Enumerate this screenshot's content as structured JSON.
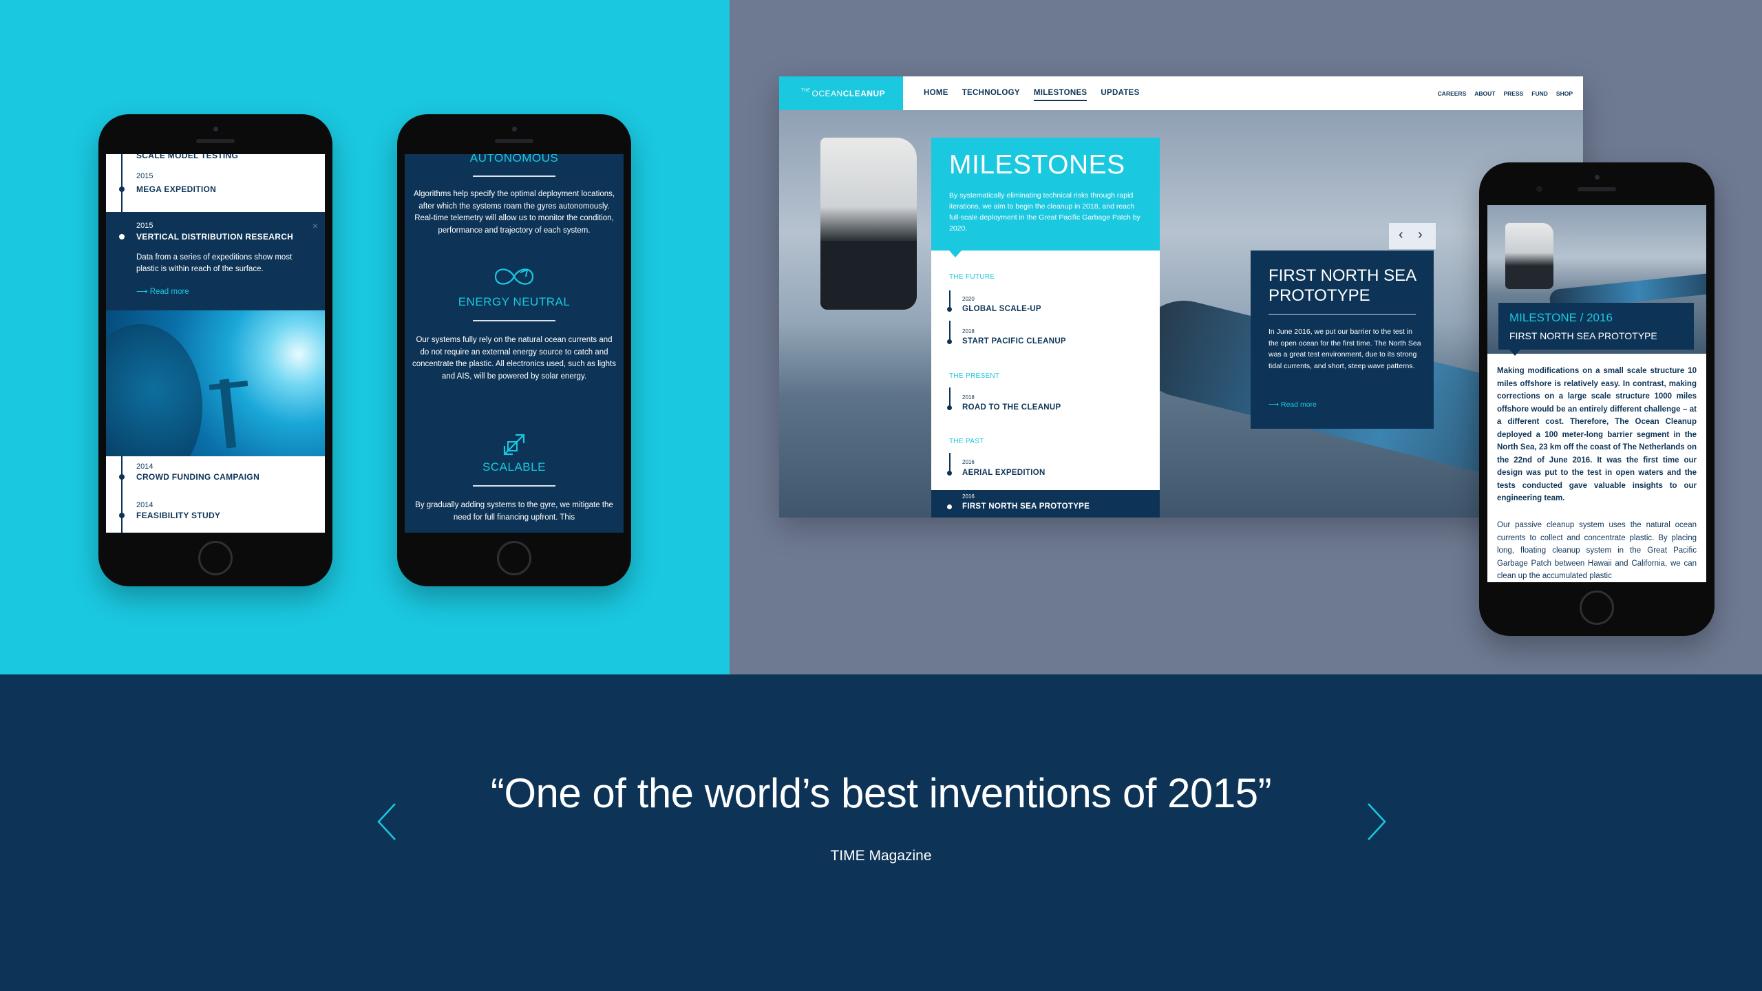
{
  "colors": {
    "cyan": "#1ac8e0",
    "navy": "#0d3457",
    "slate": "#6e7a92"
  },
  "phone1": {
    "partial_top": "SCALE MODEL TESTING",
    "items": [
      {
        "year": "2015",
        "title": "MEGA EXPEDITION"
      },
      {
        "year": "2015",
        "title": "VERTICAL DISTRIBUTION RESEARCH",
        "body": "Data from a series of expeditions show most plastic is within reach of the surface.",
        "read_more": "Read more",
        "close": "×"
      },
      {
        "year": "2014",
        "title": "CROWD FUNDING CAMPAIGN"
      },
      {
        "year": "2014",
        "title": "FEASIBILITY STUDY"
      }
    ],
    "image_icon": "underwater-photo"
  },
  "phone2": {
    "partial_heading": "AUTONOMOUS",
    "autonomous_text": "Algorithms help specify the optimal deployment locations, after which the systems roam the gyres autonomously. Real-time telemetry will allow us to monitor the condition, performance and trajectory of each system.",
    "energy_heading": "ENERGY NEUTRAL",
    "energy_text": "Our systems fully rely on the natural ocean currents and do not require an external energy source to catch and concentrate the plastic. All electronics used, such as lights and AIS, will be powered by solar energy.",
    "scalable_heading": "SCALABLE",
    "scalable_text": "By gradually adding systems to the gyre, we mitigate the need for full financing upfront. This",
    "icons": [
      "infinity-leaf-icon",
      "expand-icon"
    ]
  },
  "site": {
    "logo_small": "THE",
    "logo_thin": "OCEAN",
    "logo_bold": "CLEANUP",
    "nav_main": [
      "HOME",
      "TECHNOLOGY",
      "MILESTONES",
      "UPDATES"
    ],
    "nav_active": "MILESTONES",
    "nav_util": [
      "CAREERS",
      "ABOUT",
      "PRESS",
      "FUND",
      "SHOP"
    ],
    "milestones": {
      "title": "MILESTONES",
      "description": "By systematically eliminating technical risks through rapid iterations, we aim to begin the cleanup in 2018, and reach full-scale deployment in the Great Pacific Garbage Patch by 2020.",
      "sections": [
        "THE FUTURE",
        "THE PRESENT",
        "THE PAST"
      ],
      "items": [
        {
          "year": "2020",
          "title": "GLOBAL SCALE-UP"
        },
        {
          "year": "2018",
          "title": "START PACIFIC CLEANUP"
        },
        {
          "year": "2018",
          "title": "ROAD TO THE CLEANUP"
        },
        {
          "year": "2016",
          "title": "AERIAL EXPEDITION"
        },
        {
          "year": "2016",
          "title": "FIRST NORTH SEA PROTOTYPE"
        }
      ]
    },
    "prototype": {
      "title": "FIRST NORTH SEA PROTOTYPE",
      "body": "In June 2016, we put our barrier to the test in the open ocean for the first time. The North Sea was a great test environment, due to its strong tidal currents, and short, steep wave patterns.",
      "read_more": "Read more",
      "prev": "‹",
      "next": "›"
    }
  },
  "phone3": {
    "card_title": "MILESTONE / 2016",
    "card_subtitle": "FIRST NORTH SEA PROTOTYPE",
    "bold_paragraph": "Making modifications on a small scale structure 10 miles offshore is relatively easy. In contrast, making corrections on a large scale structure 1000 miles offshore would be an entirely different challenge – at a different cost. Therefore, The Ocean Cleanup deployed a 100 meter-long barrier segment in the North Sea, 23 km off the coast of The Netherlands on the 22nd of June 2016. It was the first time our design was put to the test in open waters and the tests conducted gave valuable insights to our engineering team.",
    "paragraph": "Our passive cleanup system uses the natural ocean currents to collect and concentrate plastic. By placing long, floating cleanup system in the Great Pacific Garbage Patch between Hawaii and California, we can clean up the accumulated plastic"
  },
  "quote": {
    "text": "“One of the world’s best inventions of 2015”",
    "source": "TIME Magazine"
  }
}
